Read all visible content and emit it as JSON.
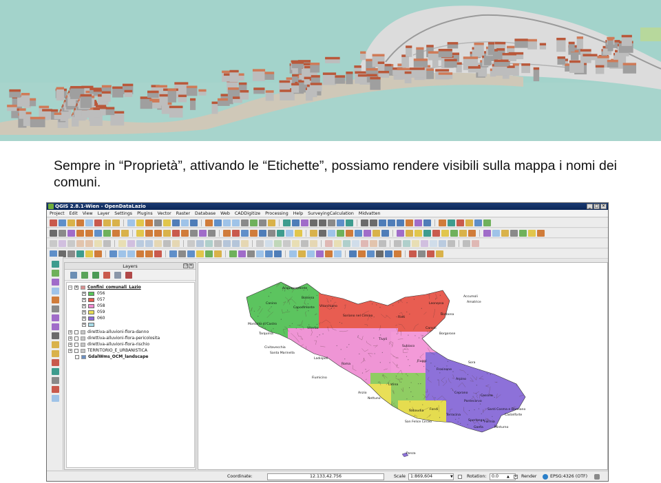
{
  "caption": "Sempre in “Proprietà”, attivando le “Etichette”, possiamo rendere visibili sulla mappa i nomi dei comuni.",
  "window": {
    "title": "QGIS 2.8.1-Wien - OpenDataLazio",
    "controls": [
      "_",
      "□",
      "✕"
    ]
  },
  "menu": [
    "Project",
    "Edit",
    "View",
    "Layer",
    "Settings",
    "Plugins",
    "Vector",
    "Raster",
    "Database",
    "Web",
    "CADDigitize",
    "Processing",
    "Help",
    "SurveyingCalculation",
    "Midvatten"
  ],
  "layers_panel": {
    "title": "Layers",
    "group": "Confini_comunali_Lazio",
    "classes": [
      {
        "label": "056",
        "color": "#58c45a"
      },
      {
        "label": "057",
        "color": "#e65a4f"
      },
      {
        "label": "058",
        "color": "#f08ad0"
      },
      {
        "label": "059",
        "color": "#e8de55"
      },
      {
        "label": "060",
        "color": "#8c6bd8"
      },
      {
        "label": "",
        "color": "#a8dce8"
      }
    ],
    "layers": [
      "direttiva-alluvioni-flora-danno",
      "direttiva-alluvioni-flora-pericolosita",
      "direttiva-alluvioni-flora-rischio",
      "TERRITORIO_E_URBANISTICA",
      "GdalWms_OCM_landscape"
    ]
  },
  "map_labels": [
    "Accumoli",
    "Amatrice",
    "Leonessa",
    "Borbona",
    "Rieti",
    "Borgorose",
    "Montalto di Castro",
    "Tarquinia",
    "Viterbo",
    "Civitavecchia",
    "Santa Marinella",
    "Ladispoli",
    "Fiumicino",
    "Roma",
    "Anzio",
    "Nettuno",
    "Latina",
    "Sabaudia",
    "San Felice Circeo",
    "Terracina",
    "Sperlonga",
    "Gaeta",
    "Formia",
    "Castelforte",
    "Santi Cosma e Damiano",
    "Ponza",
    "Frosinone",
    "Sora",
    "Cassino",
    "Fiuggi",
    "Acquapendente",
    "Canino",
    "Bolsena",
    "Capodimonte",
    "Vitorchiano",
    "Soriano nel Cimino",
    "Tivoli",
    "Subiaco",
    "Carsoli",
    "Ceprano",
    "Pontecorvo",
    "Fondi",
    "Minturno",
    "Arpino"
  ],
  "statusbar": {
    "coordinate_label": "Coordinate:",
    "coordinate_value": "12.133,42.756",
    "scale_label": "Scale",
    "scale_value": "1:869,604",
    "rotation_label": "Rotation:",
    "rotation_value": "0.0",
    "render_label": "Render",
    "crs_label": "EPSG:4326 (OTF)"
  }
}
